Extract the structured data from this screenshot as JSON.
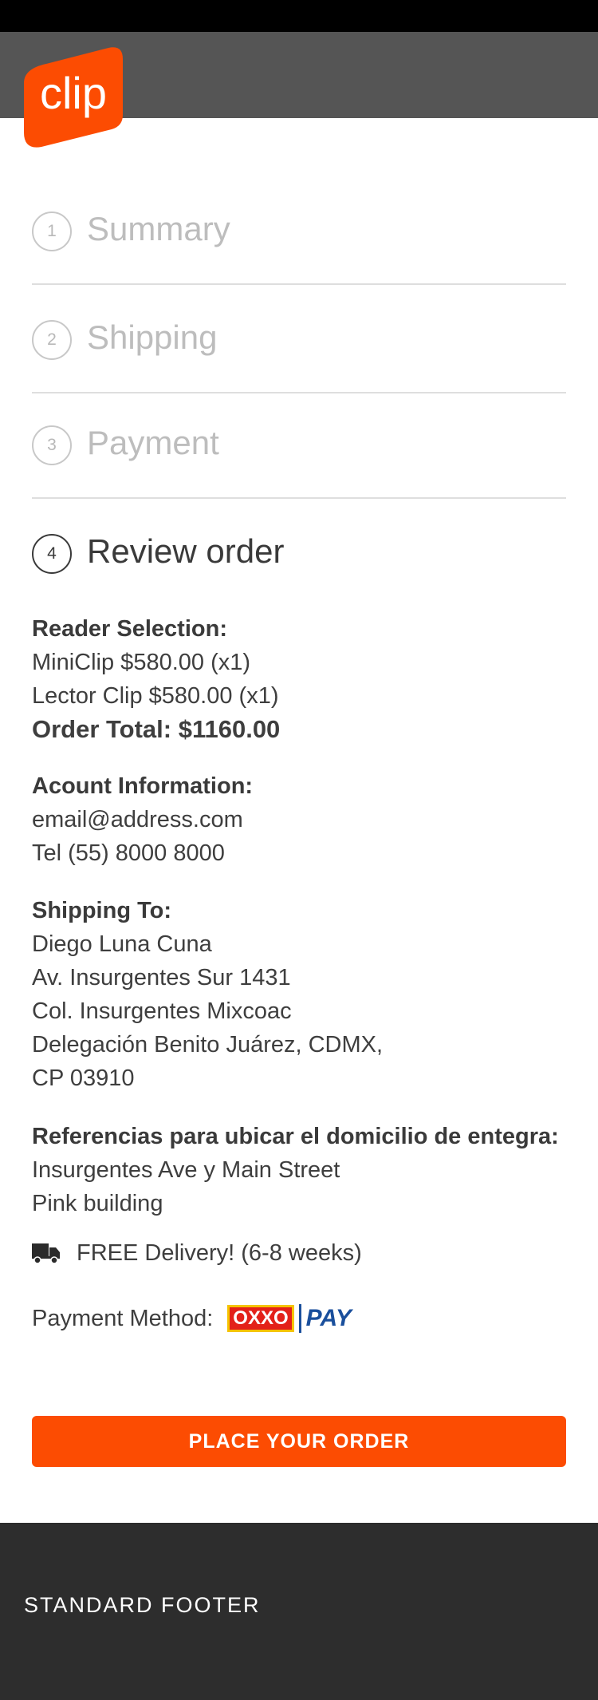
{
  "brand": {
    "logo_text": "clip",
    "accent": "#fc4c02"
  },
  "steps": [
    {
      "number": "1",
      "label": "Summary",
      "active": false
    },
    {
      "number": "2",
      "label": "Shipping",
      "active": false
    },
    {
      "number": "3",
      "label": "Payment",
      "active": false
    },
    {
      "number": "4",
      "label": "Review order",
      "active": true
    }
  ],
  "review": {
    "reader": {
      "heading": "Reader Selection:",
      "lines": [
        "MiniClip $580.00 (x1)",
        "Lector Clip $580.00  (x1)"
      ],
      "total": "Order Total: $1160.00"
    },
    "account": {
      "heading": "Acount Information:",
      "lines": [
        "email@address.com",
        "Tel (55) 8000 8000"
      ]
    },
    "shipping": {
      "heading": "Shipping To:",
      "lines": [
        "Diego Luna Cuna",
        "Av. Insurgentes Sur 1431",
        "Col. Insurgentes Mixcoac",
        "Delegación Benito Juárez, CDMX,",
        "CP 03910"
      ]
    },
    "references": {
      "heading": "Referencias para ubicar el domicilio de entegra:",
      "lines": [
        "Insurgentes Ave y Main Street",
        "Pink building"
      ]
    },
    "delivery": {
      "icon": "truck-icon",
      "text": "FREE Delivery! (6-8 weeks)"
    },
    "payment": {
      "label": "Payment Method:",
      "logo_box": "OXXO",
      "logo_pay": "PAY"
    }
  },
  "cta": {
    "label": "PLACE YOUR ORDER"
  },
  "footer": {
    "text": "STANDARD FOOTER"
  }
}
